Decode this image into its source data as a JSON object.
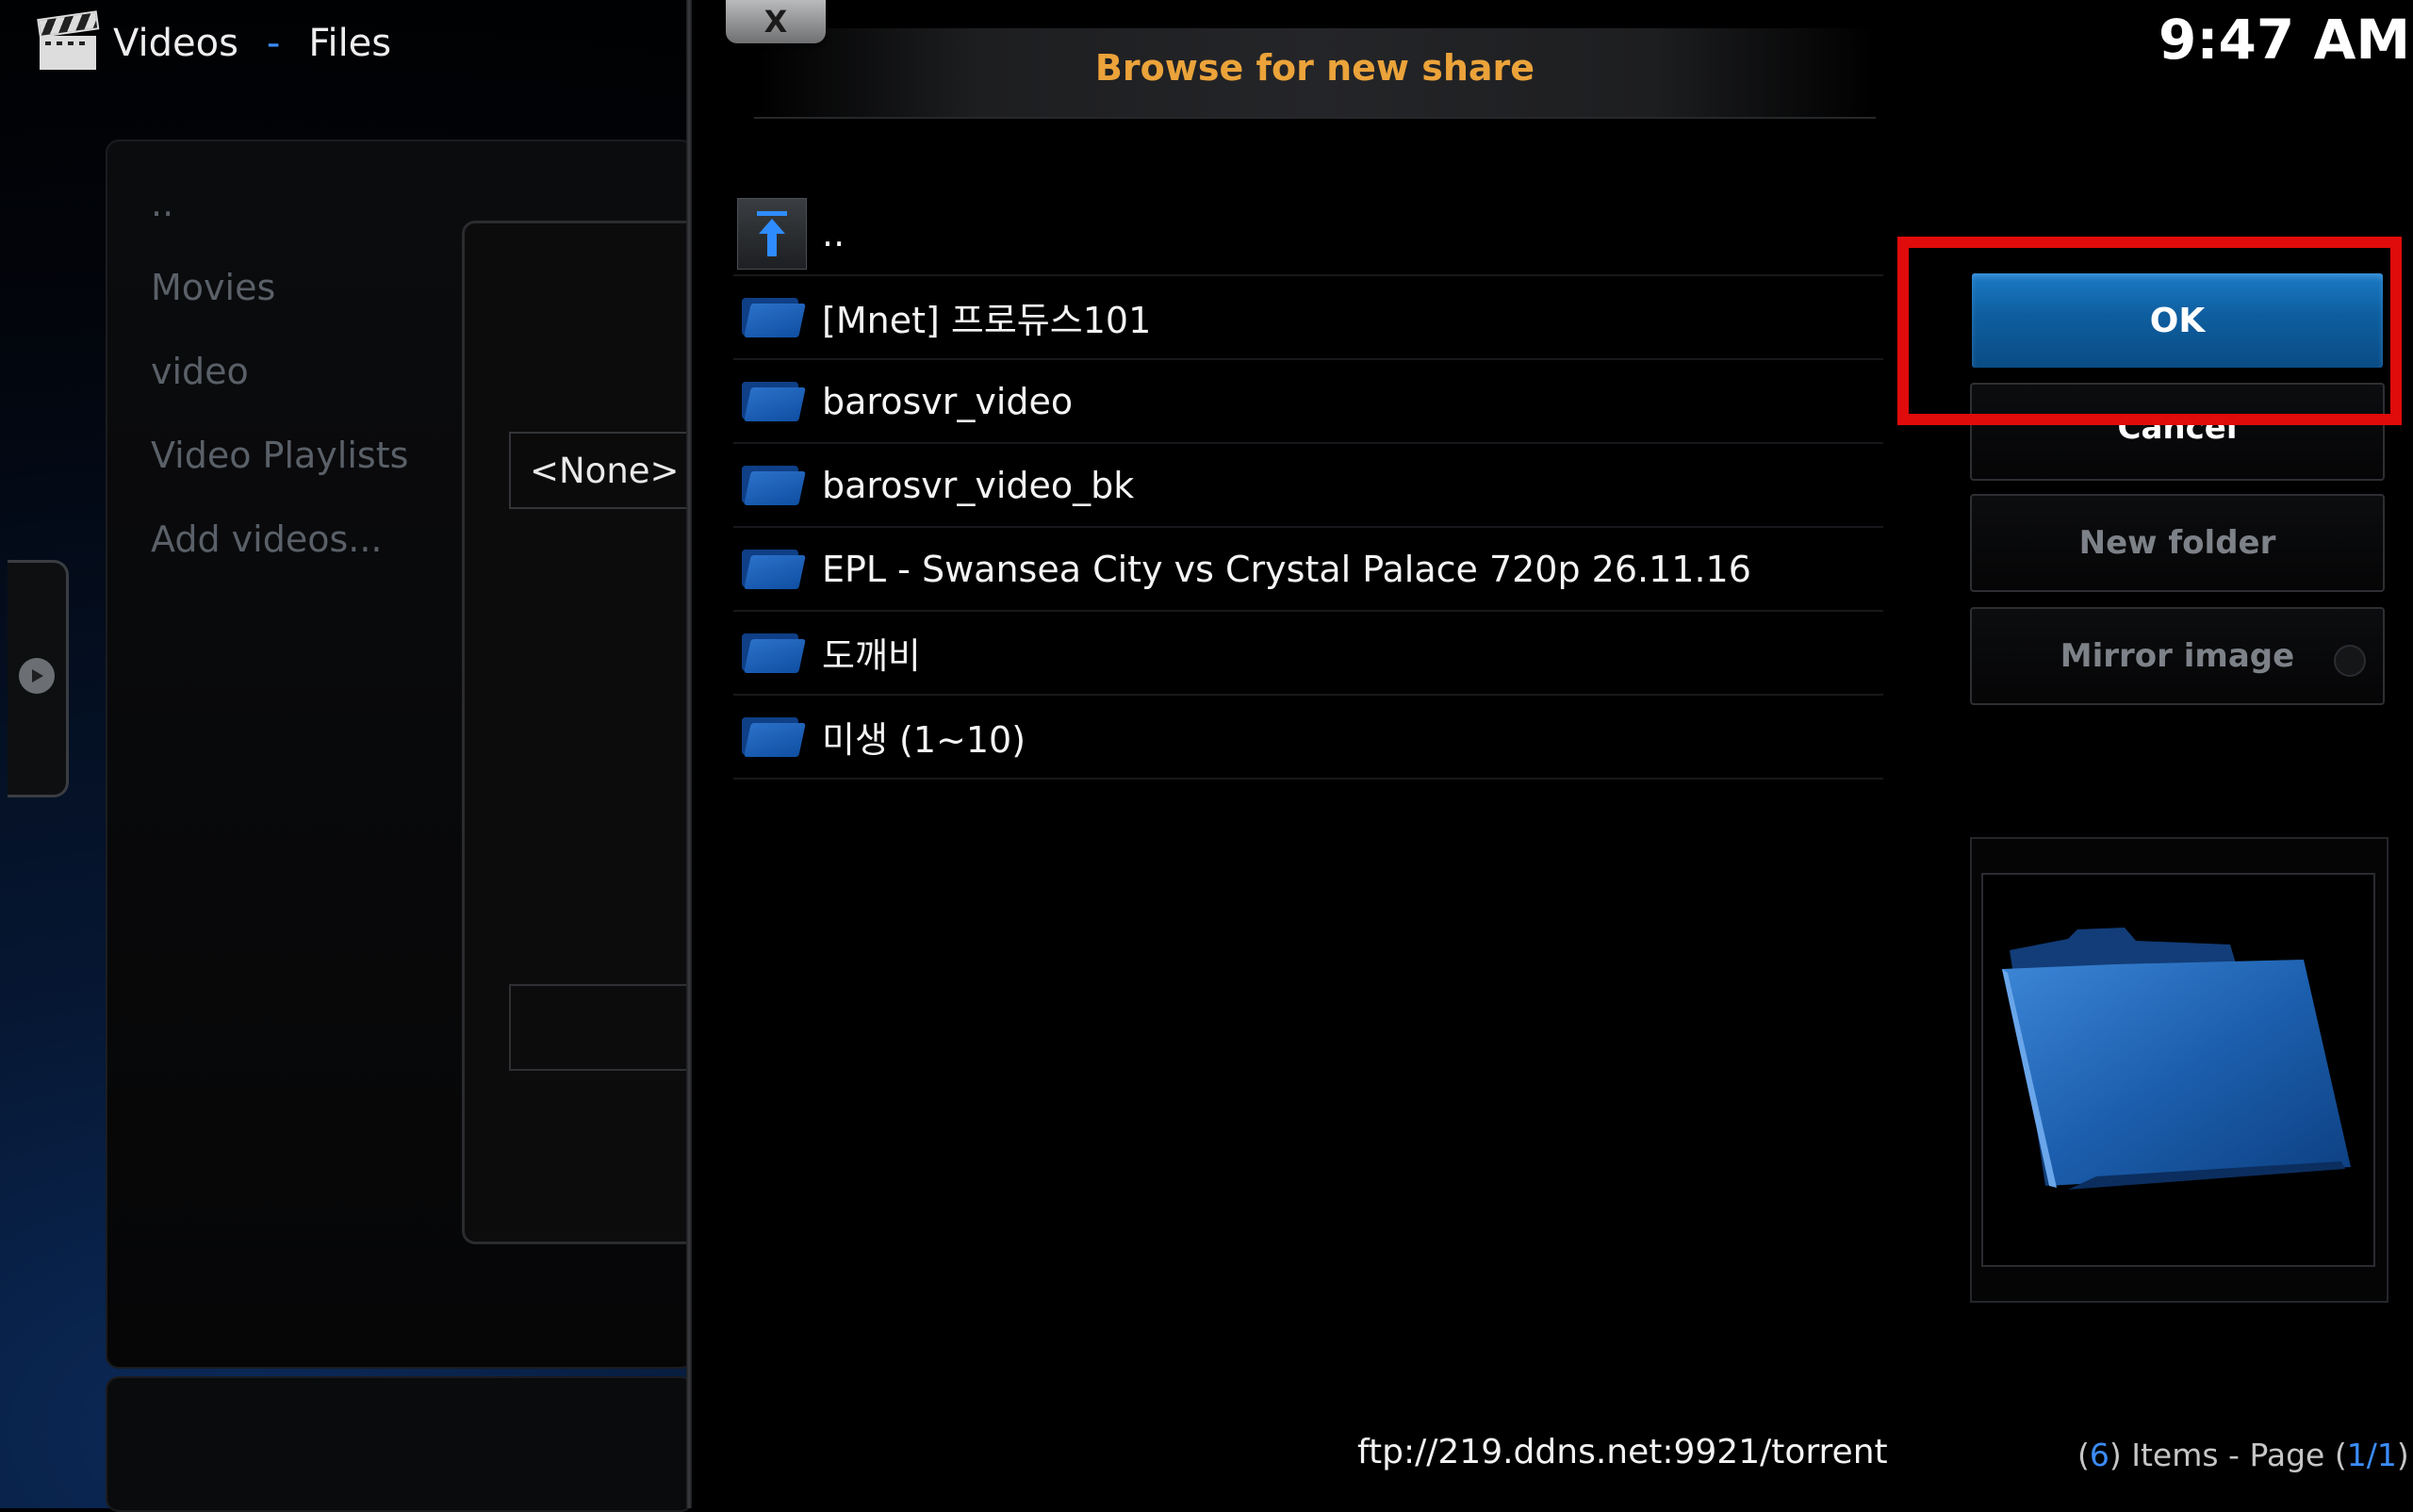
{
  "header": {
    "app": "Videos",
    "separator": "-",
    "section": "Files"
  },
  "clock": "9:47 AM",
  "left_list": [
    "..",
    "Movies",
    "video",
    "Video Playlists",
    "Add videos..."
  ],
  "background_dialog": {
    "field_value": "<None>"
  },
  "dialog": {
    "close_label": "X",
    "title": "Browse for new share",
    "items": [
      {
        "label": "..",
        "icon": "folder-up-icon"
      },
      {
        "label": "[Mnet] 프로듀스101",
        "icon": "folder-icon"
      },
      {
        "label": "barosvr_video",
        "icon": "folder-icon"
      },
      {
        "label": "barosvr_video_bk",
        "icon": "folder-icon"
      },
      {
        "label": "EPL - Swansea City vs Crystal Palace 720p 26.11.16",
        "icon": "folder-icon"
      },
      {
        "label": "도깨비",
        "icon": "folder-icon"
      },
      {
        "label": "미생 (1~10)",
        "icon": "folder-icon"
      }
    ],
    "current_path": "ftp://219.ddns.net:9921/torrent"
  },
  "buttons": {
    "ok": "OK",
    "cancel": "Cancel",
    "new_folder": "New folder",
    "mirror_image": "Mirror image"
  },
  "footer": {
    "open_paren": "(",
    "count": "6",
    "items_text": ") Items - Page (",
    "page": "1/1",
    "close_paren": ")"
  },
  "colors": {
    "accent": "#3b8dff",
    "title": "#eba33a",
    "ok_button": "#0e5e9f",
    "highlight": "#e00b0b"
  }
}
